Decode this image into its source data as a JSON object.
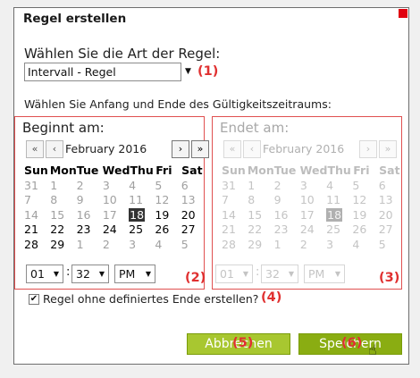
{
  "dialog": {
    "title": "Regel erstellen",
    "rule_type_label": "Wählen Sie die Art der Regel:",
    "rule_type_value": "Intervall - Regel",
    "range_label": "Wählen Sie Anfang und Ende des Gültigkeitszeitraums:",
    "annotations": [
      "(1)",
      "(2)",
      "(3)",
      "(4)",
      "(5)",
      "(6)"
    ]
  },
  "start": {
    "title": "Beginnt am:",
    "nav": [
      "«",
      "‹",
      "›",
      "»"
    ],
    "month": "February 2016",
    "weekdays": [
      "Sun",
      "Mon",
      "Tue",
      "Wed",
      "Thu",
      "Fri",
      "Sat"
    ],
    "weeks": [
      [
        "31",
        "1",
        "2",
        "3",
        "4",
        "5",
        "6"
      ],
      [
        "7",
        "8",
        "9",
        "10",
        "11",
        "12",
        "13"
      ],
      [
        "14",
        "15",
        "16",
        "17",
        "18",
        "19",
        "20"
      ],
      [
        "21",
        "22",
        "23",
        "24",
        "25",
        "26",
        "27"
      ],
      [
        "28",
        "29",
        "1",
        "2",
        "3",
        "4",
        "5"
      ]
    ],
    "hour": "01",
    "minute": "32",
    "ampm": "PM"
  },
  "end": {
    "title": "Endet am:",
    "nav": [
      "«",
      "‹",
      "›",
      "»"
    ],
    "month": "February 2016",
    "weekdays": [
      "Sun",
      "Mon",
      "Tue",
      "Wed",
      "Thu",
      "Fri",
      "Sat"
    ],
    "weeks": [
      [
        "31",
        "1",
        "2",
        "3",
        "4",
        "5",
        "6"
      ],
      [
        "7",
        "8",
        "9",
        "10",
        "11",
        "12",
        "13"
      ],
      [
        "14",
        "15",
        "16",
        "17",
        "18",
        "19",
        "20"
      ],
      [
        "21",
        "22",
        "23",
        "24",
        "25",
        "26",
        "27"
      ],
      [
        "28",
        "29",
        "1",
        "2",
        "3",
        "4",
        "5"
      ]
    ],
    "hour": "01",
    "minute": "32",
    "ampm": "PM"
  },
  "no_end": {
    "label": "Regel ohne definiertes Ende erstellen?",
    "checked": true,
    "check_mark": "✔"
  },
  "buttons": {
    "cancel": "Abbrechen",
    "save": "Speichern"
  },
  "icons": {
    "dropdown": "▼",
    "cursor": "hand-pointer-icon"
  },
  "colors": {
    "annotation": "#e03030",
    "button": "#a8c730",
    "panel_border": "#e05050"
  }
}
